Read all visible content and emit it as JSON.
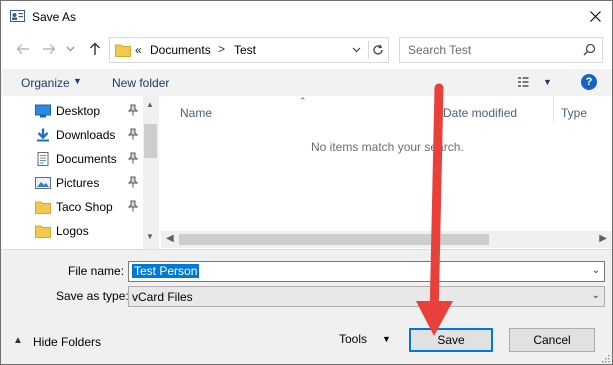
{
  "window": {
    "title": "Save As"
  },
  "address": {
    "overflow_chevron": "«",
    "crumbs": [
      "Documents",
      "Test"
    ],
    "separator": ">"
  },
  "search": {
    "placeholder": "Search Test"
  },
  "toolbar": {
    "organize_label": "Organize",
    "new_folder_label": "New folder",
    "help_label": "?"
  },
  "nav": {
    "items": [
      {
        "label": "Desktop",
        "icon": "desktop-icon",
        "pinned": true
      },
      {
        "label": "Downloads",
        "icon": "download-icon",
        "pinned": true
      },
      {
        "label": "Documents",
        "icon": "documents-icon",
        "pinned": true
      },
      {
        "label": "Pictures",
        "icon": "pictures-icon",
        "pinned": true
      },
      {
        "label": "Taco Shop",
        "icon": "folder-icon",
        "pinned": true
      },
      {
        "label": "Logos",
        "icon": "folder-icon",
        "pinned": false
      }
    ]
  },
  "filelist": {
    "columns": [
      "Name",
      "Date modified",
      "Type"
    ],
    "empty_message": "No items match your search."
  },
  "form": {
    "file_name_label": "File name:",
    "file_name_value": "Test Person",
    "save_type_label": "Save as type:",
    "save_type_value": "vCard Files"
  },
  "footer": {
    "hide_folders_label": "Hide Folders",
    "tools_label": "Tools",
    "save_label": "Save",
    "cancel_label": "Cancel"
  },
  "colors": {
    "accent": "#0078d7",
    "annotation_arrow": "#e8403a",
    "folder": "#f2c94c"
  }
}
